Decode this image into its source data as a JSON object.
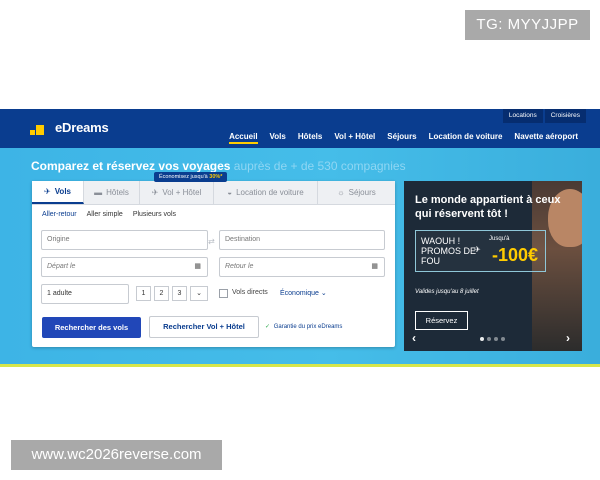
{
  "watermarks": {
    "top": "TG: MYYJJPP",
    "bottom": "www.wc2026reverse.com"
  },
  "site": {
    "logo_text": "eDreams",
    "mini_links": [
      "Locations",
      "Croisières"
    ],
    "nav": [
      {
        "label": "Accueil",
        "active": true
      },
      {
        "label": "Vols"
      },
      {
        "label": "Hôtels"
      },
      {
        "label": "Vol + Hôtel"
      },
      {
        "label": "Séjours"
      },
      {
        "label": "Location de voiture"
      },
      {
        "label": "Navette aéroport"
      }
    ],
    "colors": {
      "brand_blue": "#0a3d8f",
      "accent_yellow": "#ffcc00",
      "hero_blue": "#45bde9",
      "button_blue": "#2147b8"
    }
  },
  "hero": {
    "title_bold": "Comparez et réservez vos voyages",
    "title_soft": "auprès de + de 530 compagnies"
  },
  "search": {
    "tabs": [
      {
        "label": "Vols",
        "icon": "plane-icon",
        "glyph": "✈",
        "active": true
      },
      {
        "label": "Hôtels",
        "icon": "bed-icon",
        "glyph": "▬"
      },
      {
        "label": "Vol + Hôtel",
        "icon": "plane-hotel-icon",
        "glyph": "✈"
      },
      {
        "label": "Location de voiture",
        "icon": "car-icon",
        "glyph": "◒"
      },
      {
        "label": "Séjours",
        "icon": "sun-icon",
        "glyph": "☼"
      }
    ],
    "tooltip_text": "Économisez jusqu'à",
    "tooltip_value": "30%*",
    "trip_types": [
      "Aller-retour",
      "Aller simple",
      "Plusieurs vols"
    ],
    "origin_placeholder": "Origine",
    "destination_placeholder": "Destination",
    "depart_placeholder": "Départ le",
    "return_placeholder": "Retour le",
    "passengers_value": "1 adulte",
    "pax_buttons": [
      "1",
      "2",
      "3"
    ],
    "direct_label": "Vols directs",
    "cabin_value": "Économique",
    "search_flights_label": "Rechercher des vols",
    "search_package_label": "Rechercher Vol + Hôtel",
    "guarantee_label": "Garantie du prix eDreams"
  },
  "promo": {
    "title": "Le monde appartient à ceux qui réservent tôt !",
    "box_left": "WAOUH ! PROMOS DE FOU",
    "box_small": "Jusqu'à",
    "box_price": "-100€",
    "valid": "Valides jusqu'au 8 juillet",
    "button": "Réservez",
    "slide_count": 4,
    "active_slide": 0
  }
}
